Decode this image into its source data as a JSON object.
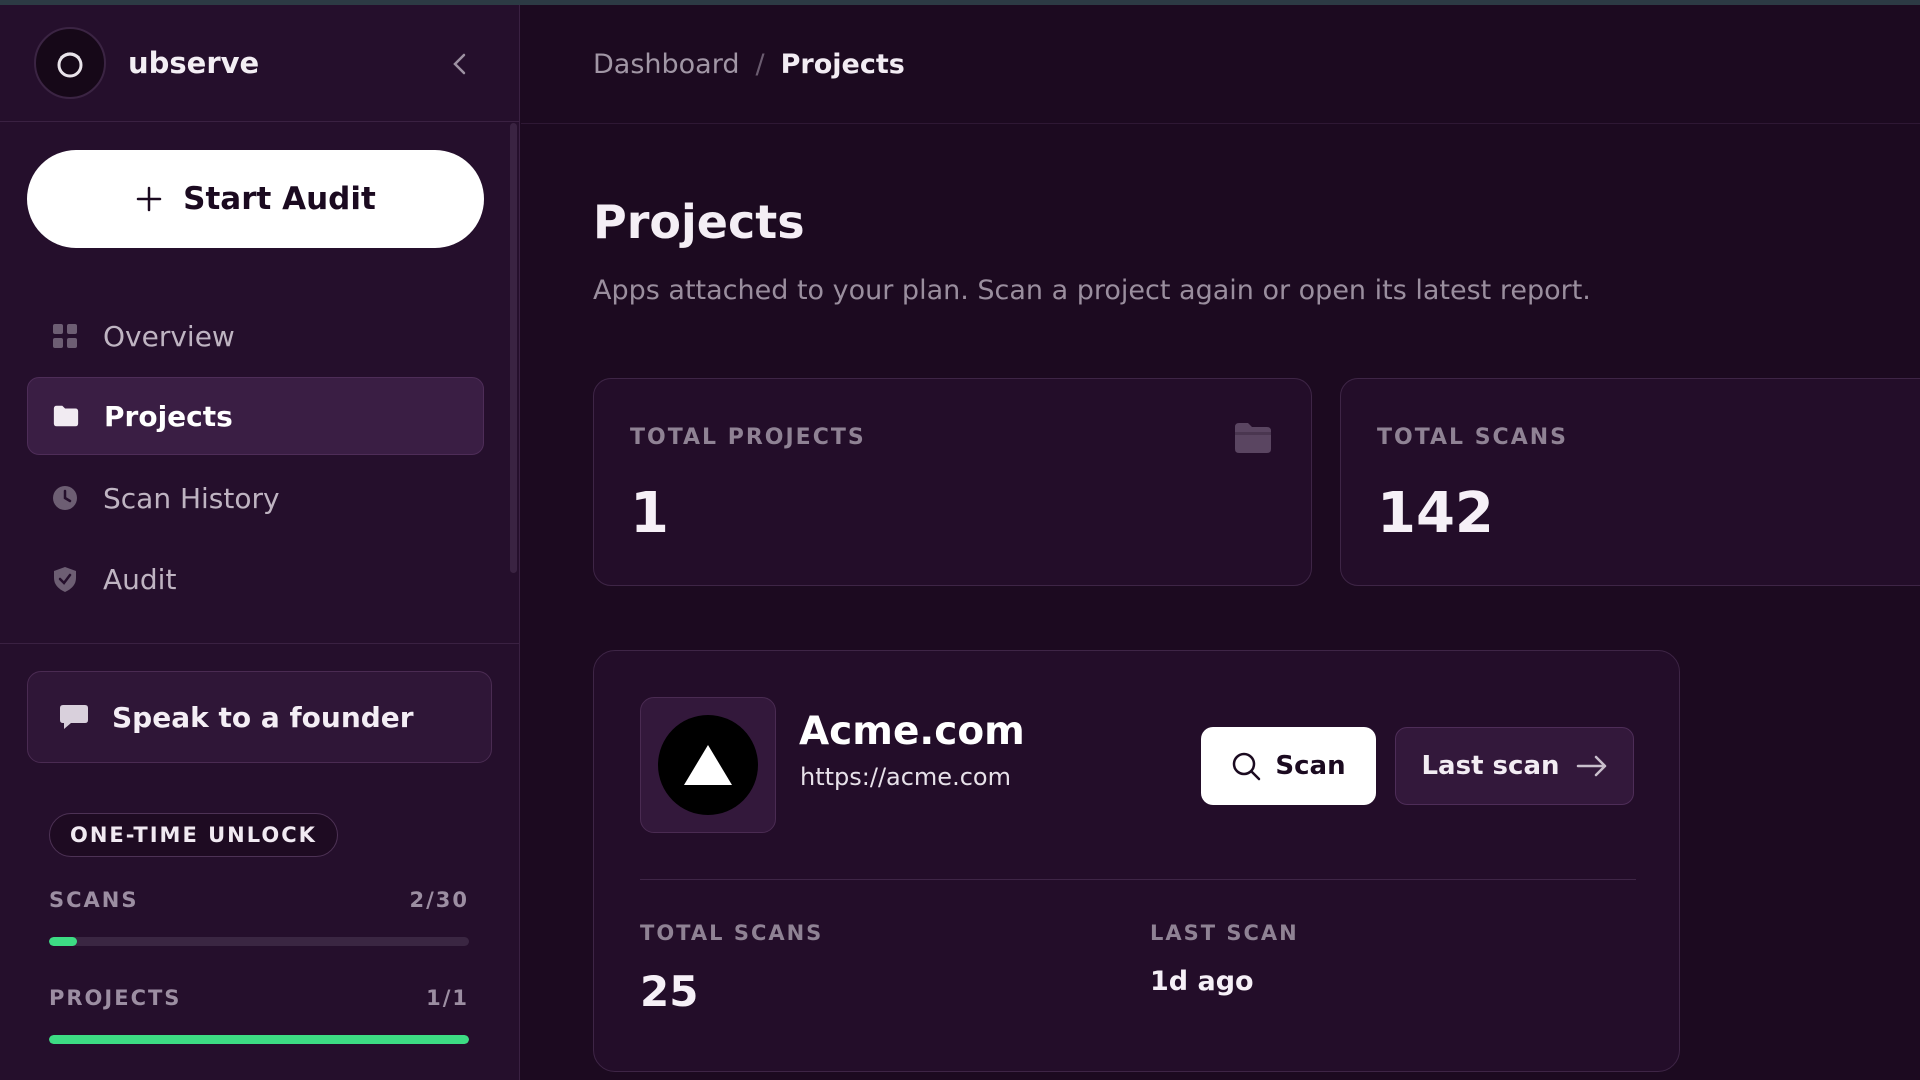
{
  "brand": {
    "name": "ubserve"
  },
  "sidebar": {
    "start_audit_label": "Start Audit",
    "items": [
      {
        "label": "Overview",
        "icon": "grid-icon",
        "active": false
      },
      {
        "label": "Projects",
        "icon": "folder-icon",
        "active": true
      },
      {
        "label": "Scan History",
        "icon": "clock-icon",
        "active": false
      },
      {
        "label": "Audit",
        "icon": "shield-icon",
        "active": false
      }
    ],
    "founder_label": "Speak to a founder",
    "plan_badge": "ONE-TIME UNLOCK",
    "usage": {
      "scans": {
        "label": "SCANS",
        "count": "2/30",
        "fraction": 0.0667
      },
      "projects": {
        "label": "PROJECTS",
        "count": "1/1",
        "fraction": 1.0
      }
    }
  },
  "breadcrumb": {
    "parent": "Dashboard",
    "separator": "/",
    "current": "Projects"
  },
  "page": {
    "title": "Projects",
    "subtitle": "Apps attached to your plan. Scan a project again or open its latest report."
  },
  "stats": {
    "total_projects": {
      "label": "TOTAL PROJECTS",
      "value": "1"
    },
    "total_scans": {
      "label": "TOTAL SCANS",
      "value": "142"
    }
  },
  "project": {
    "name": "Acme.com",
    "url": "https://acme.com",
    "scan_label": "Scan",
    "last_scan_label": "Last scan",
    "total_scans_label": "TOTAL SCANS",
    "total_scans_value": "25",
    "last_scan_meta_label": "LAST SCAN",
    "last_scan_value": "1d ago"
  },
  "colors": {
    "background": "#1c0a20",
    "sidebar": "#250f2c",
    "card": "#230d29",
    "accent_green": "#3ddc84"
  }
}
